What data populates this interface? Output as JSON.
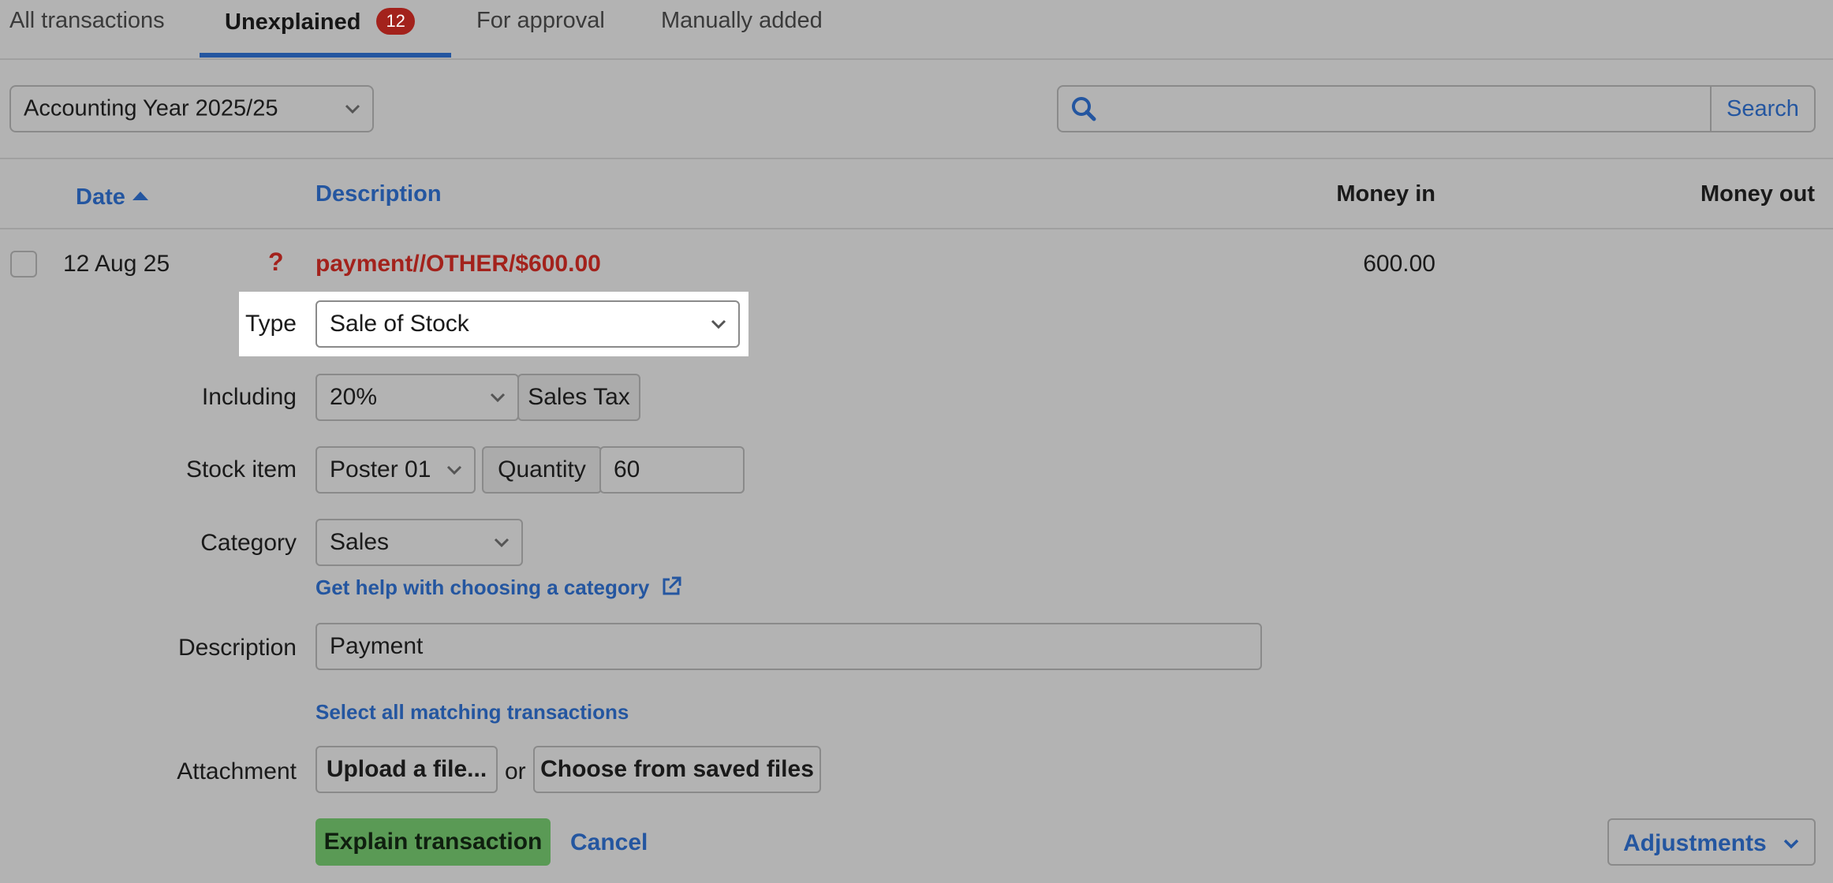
{
  "tabs": [
    {
      "label": "All transactions"
    },
    {
      "label": "Unexplained",
      "badge": "12"
    },
    {
      "label": "For approval"
    },
    {
      "label": "Manually added"
    }
  ],
  "filter": {
    "year_value": "Accounting Year 2025/25"
  },
  "search": {
    "button_label": "Search",
    "value": ""
  },
  "table": {
    "headers": {
      "date": "Date",
      "description": "Description",
      "money_in": "Money in",
      "money_out": "Money out"
    },
    "row": {
      "date": "12 Aug 25",
      "status_icon": "?",
      "description": "payment//OTHER/$600.00",
      "money_in": "600.00",
      "money_out": ""
    }
  },
  "form": {
    "type_label": "Type",
    "type_value": "Sale of Stock",
    "including_label": "Including",
    "including_value": "20%",
    "sales_tax_label": "Sales Tax",
    "stock_item_label": "Stock item",
    "stock_item_value": "Poster 01",
    "quantity_label": "Quantity",
    "quantity_value": "60",
    "category_label": "Category",
    "category_value": "Sales",
    "category_help_link": "Get help with choosing a category",
    "description_label": "Description",
    "description_value": "Payment",
    "select_matching_link": "Select all matching transactions",
    "attachment_label": "Attachment",
    "upload_label": "Upload a file...",
    "or_text": "or",
    "choose_saved_label": "Choose from saved files",
    "explain_label": "Explain transaction",
    "cancel_label": "Cancel",
    "adjustments_label": "Adjustments"
  },
  "colors": {
    "accent_blue": "#2456a0",
    "alert_red": "#a3221c",
    "explain_green": "#5a9a55",
    "background": "#b3b3b3"
  }
}
